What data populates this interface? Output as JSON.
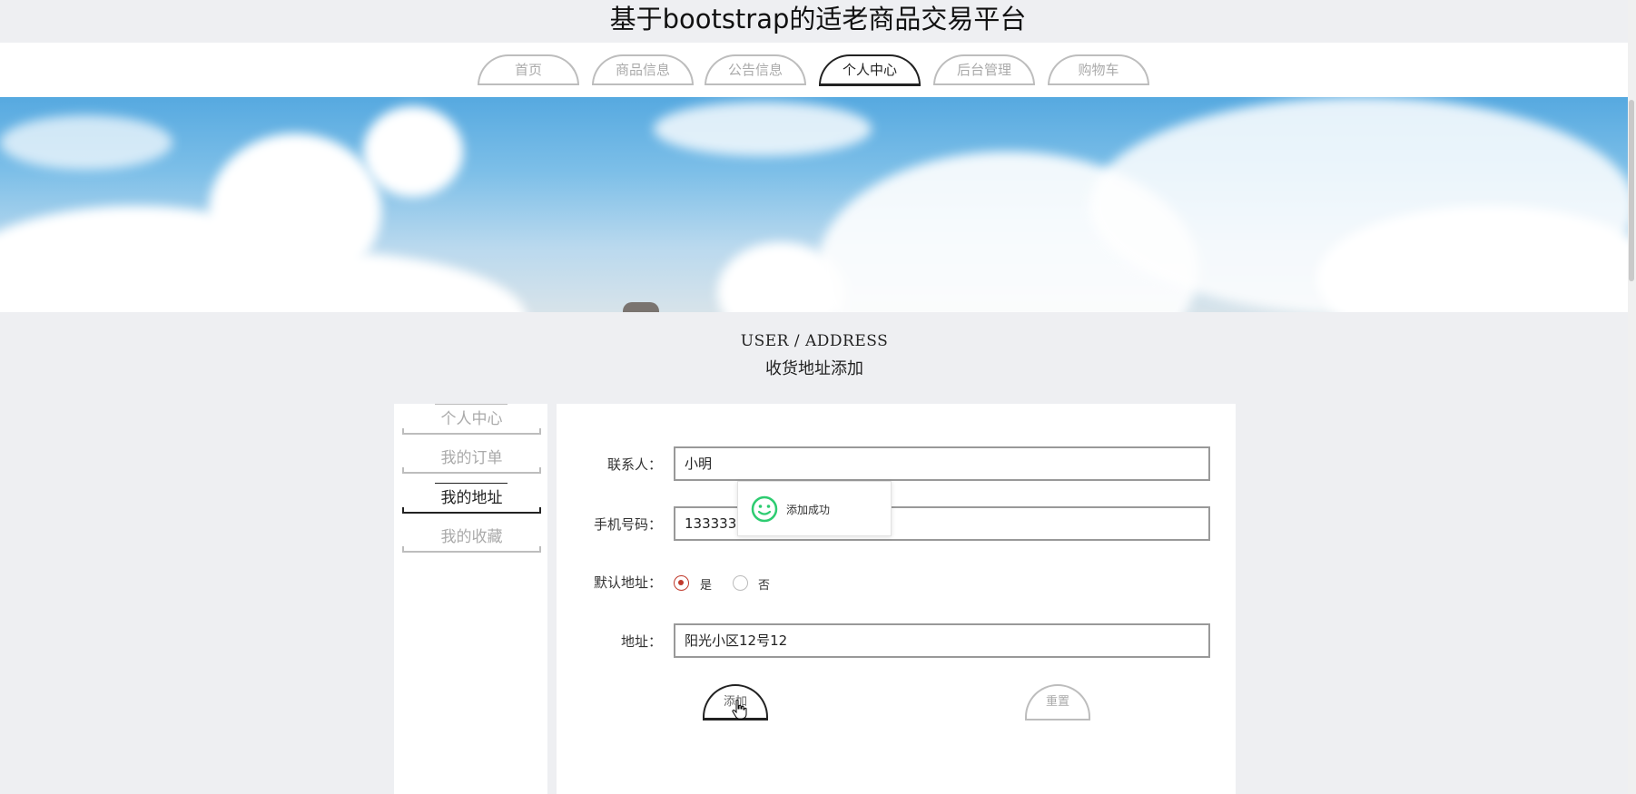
{
  "site": {
    "title": "基于bootstrap的适老商品交易平台"
  },
  "nav": {
    "items": [
      {
        "label": "首页"
      },
      {
        "label": "商品信息"
      },
      {
        "label": "公告信息"
      },
      {
        "label": "个人中心",
        "active": true
      },
      {
        "label": "后台管理"
      },
      {
        "label": "购物车"
      }
    ]
  },
  "page": {
    "heading_en": "USER / ADDRESS",
    "heading_cn": "收货地址添加"
  },
  "sidebar": {
    "items": [
      {
        "label": "个人中心"
      },
      {
        "label": "我的订单"
      },
      {
        "label": "我的地址",
        "active": true
      },
      {
        "label": "我的收藏"
      }
    ]
  },
  "form": {
    "contact": {
      "label": "联系人：",
      "value": "小明"
    },
    "phone": {
      "label": "手机号码：",
      "value": "1333336"
    },
    "default_address": {
      "label": "默认地址：",
      "options": [
        "是",
        "否"
      ],
      "selected": "是"
    },
    "address": {
      "label": "地址：",
      "value": "阳光小区12号12"
    },
    "submit_label": "添加",
    "reset_label": "重置"
  },
  "toast": {
    "message": "添加成功",
    "icon": "smile-icon"
  },
  "colors": {
    "accent_red": "#c0392b",
    "toast_green": "#2ecc71",
    "active_border": "#222222",
    "inactive_border": "#bdbdbd"
  }
}
